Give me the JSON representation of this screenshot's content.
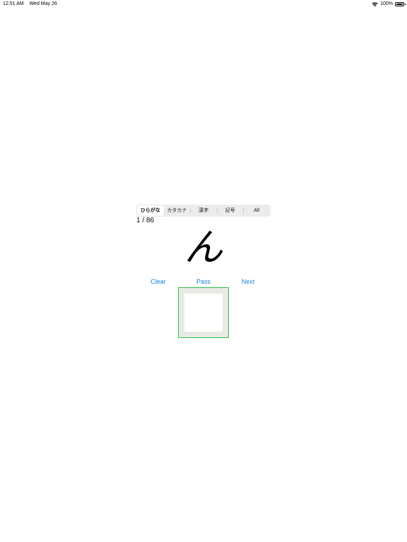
{
  "status_bar": {
    "time": "12:51 AM",
    "date": "Wed May 26",
    "battery": "100%",
    "battery_level": 1.0
  },
  "segments": [
    {
      "label": "ひらがな",
      "selected": true
    },
    {
      "label": "カタカナ",
      "selected": false
    },
    {
      "label": "漢字",
      "selected": false
    },
    {
      "label": "記号",
      "selected": false
    },
    {
      "label": "All",
      "selected": false
    }
  ],
  "counter": "1 / 86",
  "current_character": "ん",
  "actions": {
    "clear_label": "Clear",
    "pass_label": "Pass",
    "next_label": "Next"
  },
  "colors": {
    "accent_blue": "#1a7fd6",
    "canvas_border_green": "#2ec24a",
    "canvas_frame_gray": "#e9e9e6"
  }
}
